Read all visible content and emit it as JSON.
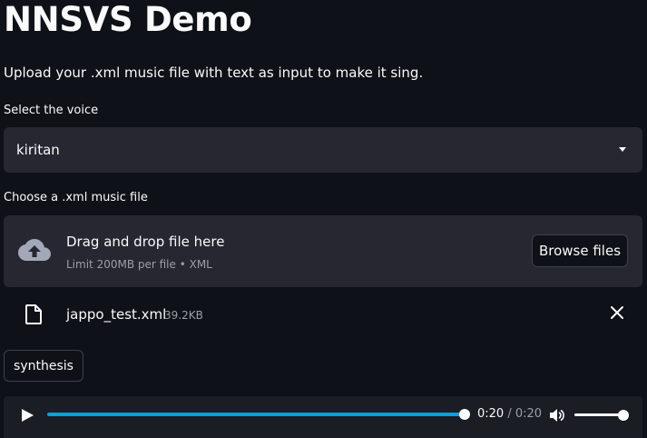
{
  "page": {
    "title": "NNSVS Demo",
    "subtitle": "Upload your .xml music file with text as input to make it sing."
  },
  "voice_select": {
    "label": "Select the voice",
    "selected": "kiritan"
  },
  "uploader": {
    "label": "Choose a .xml music file",
    "drop_text": "Drag and drop file here",
    "limit_text": "Limit 200MB per file • XML",
    "browse_label": "Browse files",
    "icon": "cloud-upload-icon"
  },
  "uploaded_file": {
    "name": "jappo_test.xml",
    "size": "39.2KB",
    "icon": "file-icon"
  },
  "synthesis_button": {
    "label": "synthesis"
  },
  "audio_player": {
    "current_time": "0:20",
    "separator": " / ",
    "duration": "0:20",
    "progress": 1.0,
    "volume": 1.0
  },
  "colors": {
    "background": "#0e1117",
    "widget_bg": "#262730",
    "accent": "#00a3e0",
    "text": "#fafafa",
    "muted_text": "#9c9ea8"
  }
}
